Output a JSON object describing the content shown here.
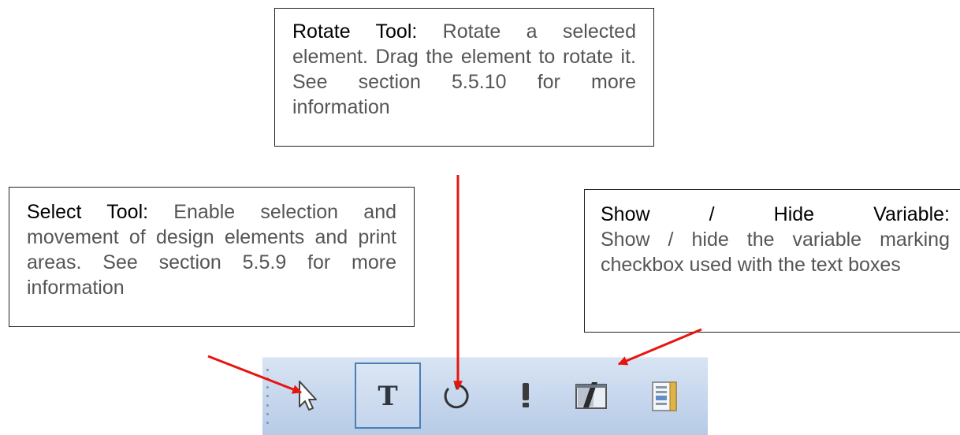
{
  "callouts": {
    "rotate": {
      "title": "Rotate Tool:",
      "text": " Rotate a selected element. Drag the element to rotate it. See section 5.5.10 for more information"
    },
    "select": {
      "title": "Select Tool:",
      "text": " Enable selection and movement of design elements and print areas. See section 5.5.9 for more information"
    },
    "variable": {
      "title_words": [
        "Show",
        "/",
        "Hide",
        "Variable:"
      ],
      "text": "Show / hide the variable marking checkbox used with the text boxes"
    }
  },
  "toolbar": {
    "tools": [
      {
        "name": "select-tool",
        "icon": "cursor-arrow-icon",
        "active": false
      },
      {
        "name": "text-tool",
        "icon": "text-t-icon",
        "active": true
      },
      {
        "name": "rotate-tool",
        "icon": "rotate-icon",
        "active": false
      },
      {
        "name": "variable-marker-tool",
        "icon": "exclamation-marker-icon",
        "active": false
      },
      {
        "name": "show-hide-variable-tool",
        "icon": "show-hide-variable-icon",
        "active": false
      },
      {
        "name": "properties-panel-tool",
        "icon": "panel-icon",
        "active": false
      }
    ]
  },
  "colors": {
    "arrow": "#e8140e",
    "toolbar_bg": "#c4d5ec",
    "active_border": "#4a7fb6"
  }
}
